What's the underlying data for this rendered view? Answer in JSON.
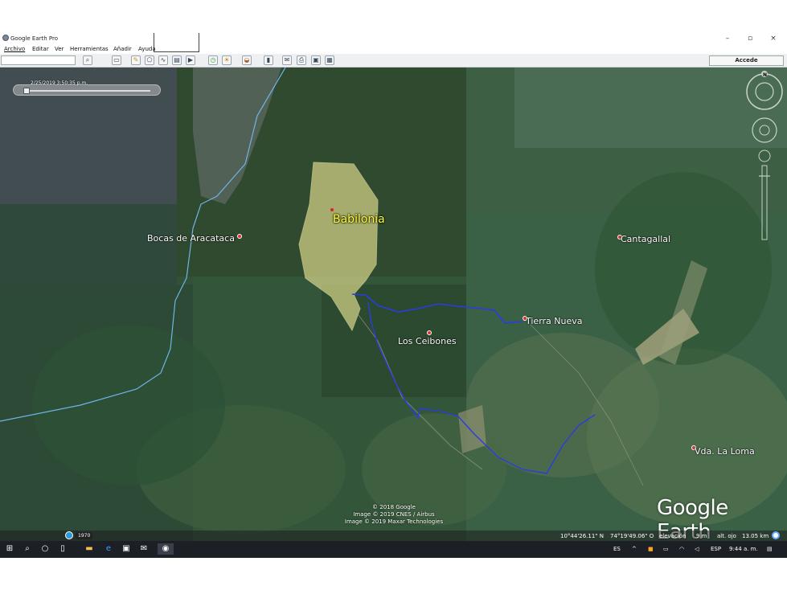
{
  "window": {
    "app_title": "Google Earth Pro",
    "minimize": "–",
    "maximize": "▫",
    "close": "×"
  },
  "menu": {
    "items": [
      "Archivo",
      "Editar",
      "Ver",
      "Herramientas",
      "Añadir",
      "Ayuda"
    ]
  },
  "toolbar": {
    "search_placeholder": "",
    "signin_label": "Accede",
    "icons": [
      "search-icon",
      "sidebar-icon",
      "placemark-icon",
      "polygon-icon",
      "path-icon",
      "overlay-icon",
      "tour-icon",
      "historical-imagery-icon",
      "sun-icon",
      "planets-icon",
      "ruler-icon",
      "email-icon",
      "print-icon",
      "save-image-icon",
      "maps-icon"
    ]
  },
  "map": {
    "time_label": "2/25/2019  3:50:35 p.m.",
    "places": [
      {
        "name": "Babilonia",
        "emphasis": true
      },
      {
        "name": "Bocas de Aracataca"
      },
      {
        "name": "Cantagallal"
      },
      {
        "name": "Tierra Nueva"
      },
      {
        "name": "Los Ceibones"
      },
      {
        "name": "Vda. La Loma"
      }
    ],
    "credits": [
      "© 2018 Google",
      "Image © 2019 CNES / Airbus",
      "Image © 2019 Maxar Technologies"
    ],
    "brand_google": "Google",
    "brand_earth": "Earth",
    "history_year": "1970",
    "compass_letter": "N"
  },
  "status": {
    "lat": "10°44'26.11\" N",
    "lon": "74°19'49.06\" O",
    "elevation_label": "elevación",
    "elevation_value": "9 m",
    "eye_alt_label": "alt. ojo",
    "eye_alt_value": "13.05 km"
  },
  "taskbar": {
    "lang_short": "ES",
    "lang_long": "ESP",
    "clock": "9:44 a. m."
  },
  "colors": {
    "route": "#2a3de0",
    "label_highlight": "#ffff33",
    "border_line": "#6fb5e6"
  }
}
